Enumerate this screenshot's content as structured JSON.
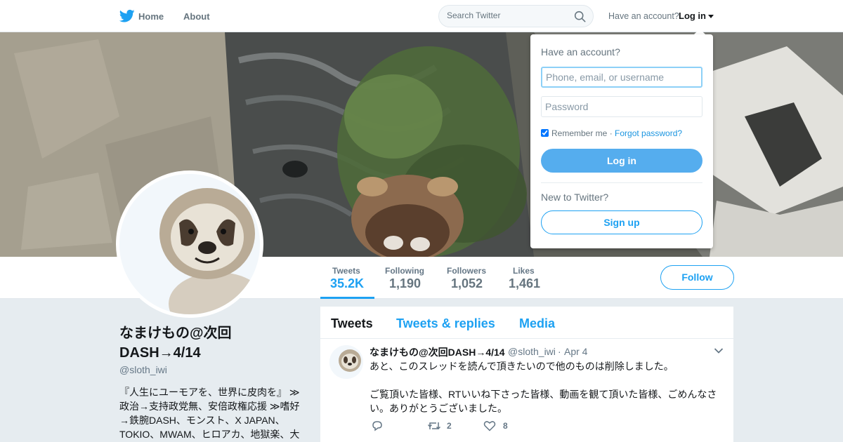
{
  "nav": {
    "home_label": "Home",
    "about_label": "About",
    "search_placeholder": "Search Twitter",
    "have_account_text": "Have an account?",
    "login_label": "Log in",
    "brand_color": "#1da1f2"
  },
  "profile": {
    "name": "なまけもの@次回DASH→4/14",
    "handle": "@sloth_iwi",
    "bio": "『人生にユーモアを、世界に皮肉を』 ≫政治→支持政党無、安倍政権応援 ≫嗜好→鉄腕DASH、モンスト、X JAPAN、TOKIO、MWAM、ヒロアカ、地獄楽、大",
    "follow_label": "Follow"
  },
  "stats": [
    {
      "label": "Tweets",
      "value": "35.2K",
      "active": true
    },
    {
      "label": "Following",
      "value": "1,190",
      "active": false
    },
    {
      "label": "Followers",
      "value": "1,052",
      "active": false
    },
    {
      "label": "Likes",
      "value": "1,461",
      "active": false
    }
  ],
  "timeline": {
    "tabs": [
      "Tweets",
      "Tweets & replies",
      "Media"
    ],
    "active_tab": "Tweets"
  },
  "tweet": {
    "name": "なまけもの@次回DASH→4/14",
    "handle": "@sloth_iwi",
    "separator": "·",
    "time": "Apr 4",
    "text_1": "あと、このスレッドを読んで頂きたいので他のものは削除しました。",
    "text_2": "ご覧頂いた皆様、RTいいね下さった皆様、動画を観て頂いた皆様、ごめんなさい。ありがとうございました。",
    "retweets": "2",
    "likes": "8"
  },
  "login_dropdown": {
    "heading": "Have an account?",
    "username_placeholder": "Phone, email, or username",
    "password_placeholder": "Password",
    "remember_label": "Remember me",
    "separator": " · ",
    "forgot_label": "Forgot password?",
    "login_button": "Log in",
    "new_text": "New to Twitter?",
    "signup_button": "Sign up"
  },
  "icons": {
    "logo": "twitter-bird-icon",
    "search": "search-icon",
    "caret": "caret-down-icon",
    "more": "chevron-down-icon",
    "reply": "reply-icon",
    "retweet": "retweet-icon",
    "like": "heart-icon"
  }
}
